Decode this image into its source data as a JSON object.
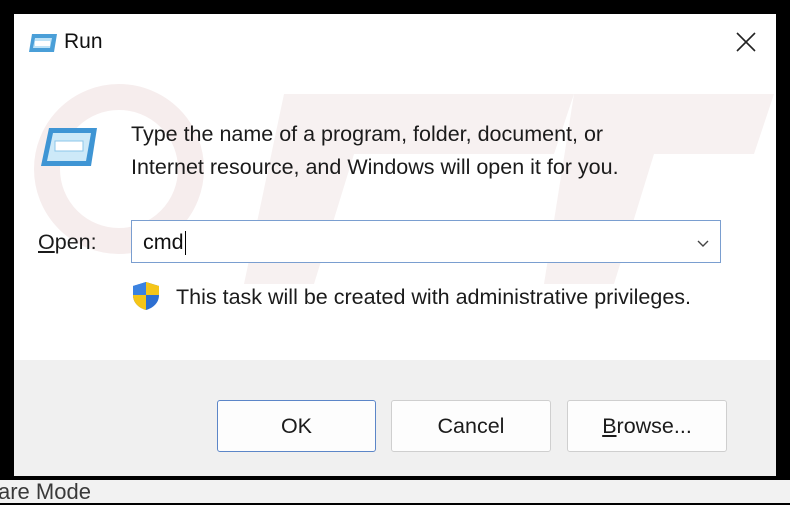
{
  "window": {
    "title": "Run",
    "close_glyph": "✕"
  },
  "dialog": {
    "message_line1": "Type the name of a program, folder, document, or",
    "message_line2": "Internet resource, and Windows will open it for you.",
    "open_label_mnemonic": "O",
    "open_label_rest": "pen:",
    "input_value": "cmd",
    "admin_notice": "This task will be created with administrative privileges."
  },
  "buttons": {
    "ok": "OK",
    "cancel": "Cancel",
    "browse_mnemonic": "B",
    "browse_rest": "rowse..."
  },
  "background": {
    "bottom_text": "are Mode"
  },
  "icons": {
    "app": "run-app-icon",
    "close": "close-icon",
    "dropdown": "chevron-down-icon",
    "shield": "uac-shield-icon"
  },
  "colors": {
    "accent_border": "#5c86c8",
    "input_border": "#7a9ed0",
    "footer_bg": "#f0f0f0"
  }
}
